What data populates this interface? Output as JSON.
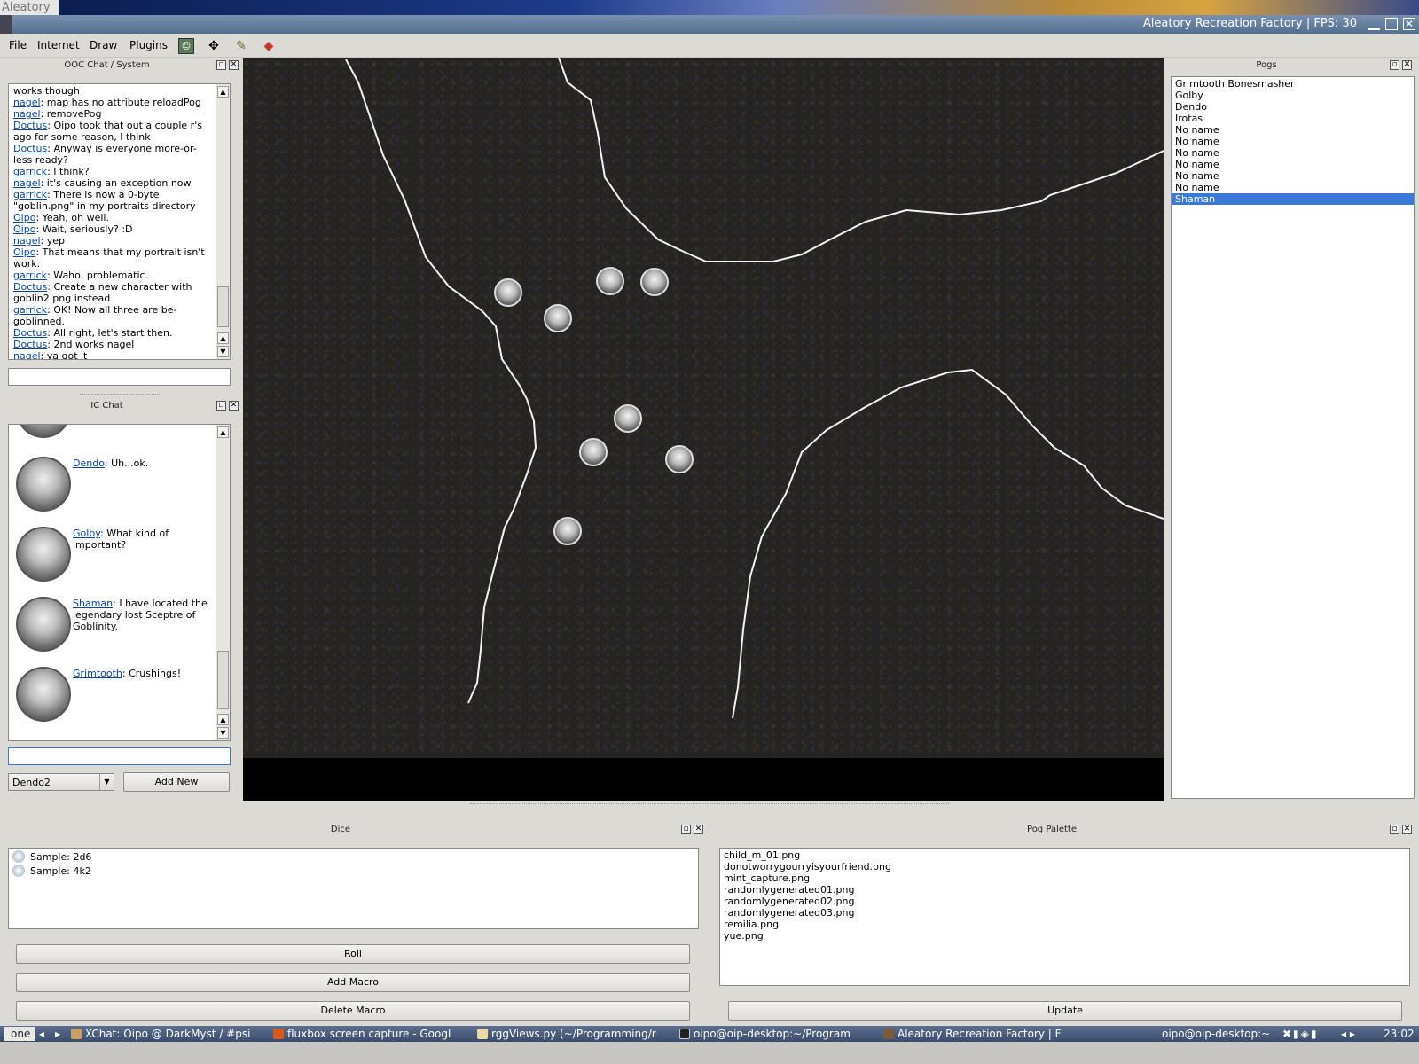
{
  "desktop": {
    "label": "Aleatory"
  },
  "window": {
    "title": "Aleatory Recreation Factory | FPS: 30"
  },
  "menu": {
    "items": [
      "File",
      "Internet",
      "Draw",
      "Plugins"
    ]
  },
  "toolbar_icons": [
    "portrait-icon",
    "move-icon",
    "draw-icon",
    "eraser-icon"
  ],
  "ooc": {
    "title": "OOC Chat / System",
    "lines": [
      {
        "user": "",
        "text": "works though"
      },
      {
        "user": "nagel",
        "text": ": map has no attribute reloadPog"
      },
      {
        "user": "nagel",
        "text": ": removePog"
      },
      {
        "user": "Doctus",
        "text": ": Oipo took that out a couple r's ago for some reason, I think"
      },
      {
        "user": "Doctus",
        "text": ": Anyway is everyone more-or-less ready?"
      },
      {
        "user": "garrick",
        "text": ": I think?"
      },
      {
        "user": "nagel",
        "text": ": it's causing an exception now"
      },
      {
        "user": "garrick",
        "text": ": There is now a 0-byte \"goblin.png\" in my portraits directory"
      },
      {
        "user": "Oipo",
        "text": ": Yeah, oh well."
      },
      {
        "user": "Oipo",
        "text": ": Wait, seriously? :D"
      },
      {
        "user": "nagel",
        "text": ": yep"
      },
      {
        "user": "Oipo",
        "text": ": That means that my portrait isn't work."
      },
      {
        "user": "garrick",
        "text": ": Waho, problematic."
      },
      {
        "user": "Doctus",
        "text": ": Create a new character with goblin2.png instead"
      },
      {
        "user": "garrick",
        "text": ": OK! Now all three are be-goblinned."
      },
      {
        "user": "Doctus",
        "text": ": All right, let's start then."
      },
      {
        "user": "Doctus",
        "text": ": 2nd works nagel"
      },
      {
        "user": "nagel",
        "text": ": ya got it"
      }
    ],
    "input_value": ""
  },
  "ic": {
    "title": "IC Chat",
    "entries": [
      {
        "user": "Dendo",
        "text": ": Uh...ok."
      },
      {
        "user": "Golby",
        "text": ": What kind of important?"
      },
      {
        "user": "Shaman",
        "text": ": I have located the legendary lost Sceptre of Goblinity."
      },
      {
        "user": "Grimtooth",
        "text": ": Crushings!"
      }
    ],
    "input_value": "",
    "character_select": "Dendo2",
    "add_new_label": "Add New"
  },
  "pogs": {
    "title": "Pogs",
    "items": [
      "Grimtooth Bonesmasher",
      "Golby",
      "Dendo",
      "Irotas",
      "No name",
      "No name",
      "No name",
      "No name",
      "No name",
      "No name",
      "Shaman"
    ],
    "selected_index": 10
  },
  "dice": {
    "title": "Dice",
    "macros": [
      "Sample: 2d6",
      "Sample: 4k2"
    ],
    "buttons": {
      "roll": "Roll",
      "add_macro": "Add Macro",
      "delete_macro": "Delete Macro"
    }
  },
  "pog_palette": {
    "title": "Pog Palette",
    "files": [
      "child_m_01.png",
      "donotworrygourryisyourfriend.png",
      "mint_capture.png",
      "randomlygenerated01.png",
      "randomlygenerated02.png",
      "randomlygenerated03.png",
      "remilia.png",
      "yue.png"
    ],
    "update_label": "Update"
  },
  "taskbar": {
    "workspace": "one",
    "tasks": [
      "XChat: Oipo @ DarkMyst / #psi",
      "fluxbox screen capture - Googl",
      "rggViews.py (~/Programming/r",
      "oipo@oip-desktop:~/Program",
      "Aleatory Recreation Factory | F",
      "oipo@oip-desktop:~"
    ],
    "clock": "23:02"
  },
  "colors": {
    "selection": "#3b78d8",
    "link": "#0645ad",
    "map_bg": "#262422"
  }
}
